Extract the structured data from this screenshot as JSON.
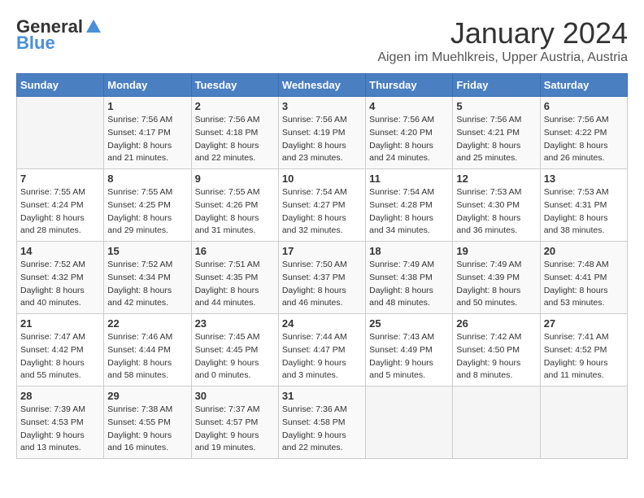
{
  "header": {
    "logo_general": "General",
    "logo_blue": "Blue",
    "month": "January 2024",
    "location": "Aigen im Muehlkreis, Upper Austria, Austria"
  },
  "weekdays": [
    "Sunday",
    "Monday",
    "Tuesday",
    "Wednesday",
    "Thursday",
    "Friday",
    "Saturday"
  ],
  "weeks": [
    [
      {
        "day": "",
        "sunrise": "",
        "sunset": "",
        "daylight": ""
      },
      {
        "day": "1",
        "sunrise": "Sunrise: 7:56 AM",
        "sunset": "Sunset: 4:17 PM",
        "daylight": "Daylight: 8 hours and 21 minutes."
      },
      {
        "day": "2",
        "sunrise": "Sunrise: 7:56 AM",
        "sunset": "Sunset: 4:18 PM",
        "daylight": "Daylight: 8 hours and 22 minutes."
      },
      {
        "day": "3",
        "sunrise": "Sunrise: 7:56 AM",
        "sunset": "Sunset: 4:19 PM",
        "daylight": "Daylight: 8 hours and 23 minutes."
      },
      {
        "day": "4",
        "sunrise": "Sunrise: 7:56 AM",
        "sunset": "Sunset: 4:20 PM",
        "daylight": "Daylight: 8 hours and 24 minutes."
      },
      {
        "day": "5",
        "sunrise": "Sunrise: 7:56 AM",
        "sunset": "Sunset: 4:21 PM",
        "daylight": "Daylight: 8 hours and 25 minutes."
      },
      {
        "day": "6",
        "sunrise": "Sunrise: 7:56 AM",
        "sunset": "Sunset: 4:22 PM",
        "daylight": "Daylight: 8 hours and 26 minutes."
      }
    ],
    [
      {
        "day": "7",
        "sunrise": "Sunrise: 7:55 AM",
        "sunset": "Sunset: 4:24 PM",
        "daylight": "Daylight: 8 hours and 28 minutes."
      },
      {
        "day": "8",
        "sunrise": "Sunrise: 7:55 AM",
        "sunset": "Sunset: 4:25 PM",
        "daylight": "Daylight: 8 hours and 29 minutes."
      },
      {
        "day": "9",
        "sunrise": "Sunrise: 7:55 AM",
        "sunset": "Sunset: 4:26 PM",
        "daylight": "Daylight: 8 hours and 31 minutes."
      },
      {
        "day": "10",
        "sunrise": "Sunrise: 7:54 AM",
        "sunset": "Sunset: 4:27 PM",
        "daylight": "Daylight: 8 hours and 32 minutes."
      },
      {
        "day": "11",
        "sunrise": "Sunrise: 7:54 AM",
        "sunset": "Sunset: 4:28 PM",
        "daylight": "Daylight: 8 hours and 34 minutes."
      },
      {
        "day": "12",
        "sunrise": "Sunrise: 7:53 AM",
        "sunset": "Sunset: 4:30 PM",
        "daylight": "Daylight: 8 hours and 36 minutes."
      },
      {
        "day": "13",
        "sunrise": "Sunrise: 7:53 AM",
        "sunset": "Sunset: 4:31 PM",
        "daylight": "Daylight: 8 hours and 38 minutes."
      }
    ],
    [
      {
        "day": "14",
        "sunrise": "Sunrise: 7:52 AM",
        "sunset": "Sunset: 4:32 PM",
        "daylight": "Daylight: 8 hours and 40 minutes."
      },
      {
        "day": "15",
        "sunrise": "Sunrise: 7:52 AM",
        "sunset": "Sunset: 4:34 PM",
        "daylight": "Daylight: 8 hours and 42 minutes."
      },
      {
        "day": "16",
        "sunrise": "Sunrise: 7:51 AM",
        "sunset": "Sunset: 4:35 PM",
        "daylight": "Daylight: 8 hours and 44 minutes."
      },
      {
        "day": "17",
        "sunrise": "Sunrise: 7:50 AM",
        "sunset": "Sunset: 4:37 PM",
        "daylight": "Daylight: 8 hours and 46 minutes."
      },
      {
        "day": "18",
        "sunrise": "Sunrise: 7:49 AM",
        "sunset": "Sunset: 4:38 PM",
        "daylight": "Daylight: 8 hours and 48 minutes."
      },
      {
        "day": "19",
        "sunrise": "Sunrise: 7:49 AM",
        "sunset": "Sunset: 4:39 PM",
        "daylight": "Daylight: 8 hours and 50 minutes."
      },
      {
        "day": "20",
        "sunrise": "Sunrise: 7:48 AM",
        "sunset": "Sunset: 4:41 PM",
        "daylight": "Daylight: 8 hours and 53 minutes."
      }
    ],
    [
      {
        "day": "21",
        "sunrise": "Sunrise: 7:47 AM",
        "sunset": "Sunset: 4:42 PM",
        "daylight": "Daylight: 8 hours and 55 minutes."
      },
      {
        "day": "22",
        "sunrise": "Sunrise: 7:46 AM",
        "sunset": "Sunset: 4:44 PM",
        "daylight": "Daylight: 8 hours and 58 minutes."
      },
      {
        "day": "23",
        "sunrise": "Sunrise: 7:45 AM",
        "sunset": "Sunset: 4:45 PM",
        "daylight": "Daylight: 9 hours and 0 minutes."
      },
      {
        "day": "24",
        "sunrise": "Sunrise: 7:44 AM",
        "sunset": "Sunset: 4:47 PM",
        "daylight": "Daylight: 9 hours and 3 minutes."
      },
      {
        "day": "25",
        "sunrise": "Sunrise: 7:43 AM",
        "sunset": "Sunset: 4:49 PM",
        "daylight": "Daylight: 9 hours and 5 minutes."
      },
      {
        "day": "26",
        "sunrise": "Sunrise: 7:42 AM",
        "sunset": "Sunset: 4:50 PM",
        "daylight": "Daylight: 9 hours and 8 minutes."
      },
      {
        "day": "27",
        "sunrise": "Sunrise: 7:41 AM",
        "sunset": "Sunset: 4:52 PM",
        "daylight": "Daylight: 9 hours and 11 minutes."
      }
    ],
    [
      {
        "day": "28",
        "sunrise": "Sunrise: 7:39 AM",
        "sunset": "Sunset: 4:53 PM",
        "daylight": "Daylight: 9 hours and 13 minutes."
      },
      {
        "day": "29",
        "sunrise": "Sunrise: 7:38 AM",
        "sunset": "Sunset: 4:55 PM",
        "daylight": "Daylight: 9 hours and 16 minutes."
      },
      {
        "day": "30",
        "sunrise": "Sunrise: 7:37 AM",
        "sunset": "Sunset: 4:57 PM",
        "daylight": "Daylight: 9 hours and 19 minutes."
      },
      {
        "day": "31",
        "sunrise": "Sunrise: 7:36 AM",
        "sunset": "Sunset: 4:58 PM",
        "daylight": "Daylight: 9 hours and 22 minutes."
      },
      {
        "day": "",
        "sunrise": "",
        "sunset": "",
        "daylight": ""
      },
      {
        "day": "",
        "sunrise": "",
        "sunset": "",
        "daylight": ""
      },
      {
        "day": "",
        "sunrise": "",
        "sunset": "",
        "daylight": ""
      }
    ]
  ]
}
